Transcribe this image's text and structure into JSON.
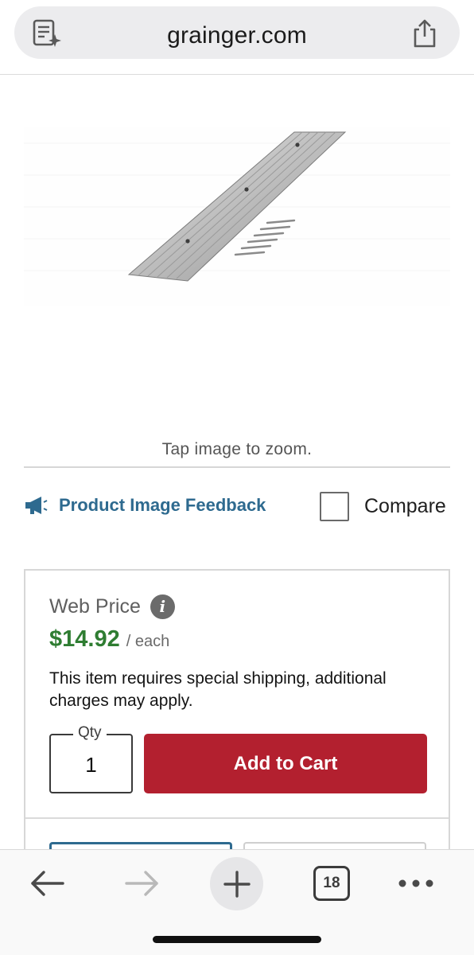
{
  "browser": {
    "domain": "grainger.com",
    "icons": {
      "reader": "reader-mode-icon",
      "share": "share-icon"
    }
  },
  "product": {
    "zoom_hint": "Tap image to zoom.",
    "feedback_label": "Product Image Feedback",
    "compare_label": "Compare",
    "compare_checked": false
  },
  "pricing": {
    "web_price_label": "Web Price",
    "info_glyph": "i",
    "price": "$14.92",
    "unit": "/ each",
    "shipping_note": "This item requires special shipping, additional charges may apply.",
    "qty_label": "Qty",
    "qty_value": "1",
    "add_to_cart_label": "Add to Cart"
  },
  "toolbar": {
    "tab_count": "18",
    "icons": [
      "back-icon",
      "forward-icon",
      "new-tab-icon",
      "tabs-icon",
      "more-icon"
    ]
  },
  "colors": {
    "brand_red": "#b3202f",
    "price_green": "#2f7d32",
    "link_blue": "#2e6a8f"
  }
}
